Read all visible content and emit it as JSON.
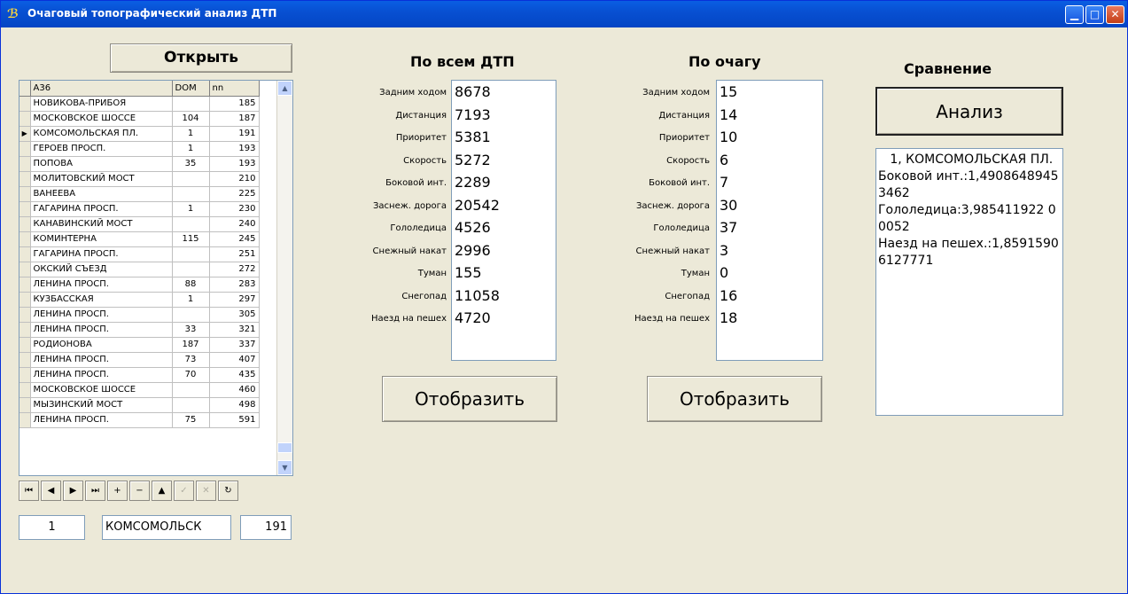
{
  "window": {
    "title": "Очаговый топографический анализ ДТП"
  },
  "open_button": "Открыть",
  "grid": {
    "columns": [
      "A36",
      "DOM",
      "nn"
    ],
    "rows": [
      [
        "НОВИКОВА-ПРИБОЯ",
        "",
        "185"
      ],
      [
        "МОСКОВСКОЕ ШОССЕ",
        "104",
        "187"
      ],
      [
        "КОМСОМОЛЬСКАЯ ПЛ.",
        "1",
        "191"
      ],
      [
        "ГЕРОЕВ ПРОСП.",
        "1",
        "193"
      ],
      [
        "ПОПОВА",
        "35",
        "193"
      ],
      [
        "МОЛИТОВСКИЙ МОСТ",
        "",
        "210"
      ],
      [
        "ВАНЕЕВА",
        "",
        "225"
      ],
      [
        "ГАГАРИНА ПРОСП.",
        "1",
        "230"
      ],
      [
        "КАНАВИНСКИЙ МОСТ",
        "",
        "240"
      ],
      [
        "КОМИНТЕРНА",
        "115",
        "245"
      ],
      [
        "ГАГАРИНА ПРОСП.",
        "",
        "251"
      ],
      [
        "ОКСКИЙ СЪЕЗД",
        "",
        "272"
      ],
      [
        "ЛЕНИНА ПРОСП.",
        "88",
        "283"
      ],
      [
        "КУЗБАССКАЯ",
        "1",
        "297"
      ],
      [
        "ЛЕНИНА ПРОСП.",
        "",
        "305"
      ],
      [
        "ЛЕНИНА ПРОСП.",
        "33",
        "321"
      ],
      [
        "РОДИОНОВА",
        "187",
        "337"
      ],
      [
        "ЛЕНИНА ПРОСП.",
        "73",
        "407"
      ],
      [
        "ЛЕНИНА ПРОСП.",
        "70",
        "435"
      ],
      [
        "МОСКОВСКОЕ ШОССЕ",
        "",
        "460"
      ],
      [
        "МЫЗИНСКИЙ МОСТ",
        "",
        "498"
      ],
      [
        "ЛЕНИНА ПРОСП.",
        "75",
        "591"
      ]
    ],
    "current_row_indicator": "▶"
  },
  "navigator": {
    "buttons": [
      {
        "name": "first",
        "glyph": "⏮"
      },
      {
        "name": "prior",
        "glyph": "◀"
      },
      {
        "name": "next",
        "glyph": "▶"
      },
      {
        "name": "last",
        "glyph": "⏭"
      },
      {
        "name": "insert",
        "glyph": "+"
      },
      {
        "name": "delete",
        "glyph": "−"
      },
      {
        "name": "edit",
        "glyph": "▲"
      },
      {
        "name": "post",
        "glyph": "✓"
      },
      {
        "name": "cancel",
        "glyph": "✕"
      },
      {
        "name": "refresh",
        "glyph": "↻"
      }
    ]
  },
  "fields": {
    "dom": "1",
    "street": "КОМСОМОЛЬСК",
    "nn": "191"
  },
  "all_accidents": {
    "title": "По всем ДТП",
    "labels": [
      "Задним ходом",
      "Дистанция",
      "Приоритет",
      "Скорость",
      "Боковой инт.",
      "Заснеж. дорога",
      "Гололедица",
      "Снежный накат",
      "Туман",
      "Снегопад",
      "Наезд на пешех"
    ],
    "values": [
      "8678",
      "7193",
      "5381",
      "5272",
      "2289",
      "20542",
      "4526",
      "2996",
      "155",
      "11058",
      "4720"
    ],
    "button": "Отобразить"
  },
  "focus": {
    "title": "По очагу",
    "labels": [
      "Задним ходом",
      "Дистанция",
      "Приоритет",
      "Скорость",
      "Боковой инт.",
      "Заснеж. дорога",
      "Гололедица",
      "Снежный накат",
      "Туман",
      "Снегопад",
      "Наезд на пешех"
    ],
    "values": [
      "15",
      "14",
      "10",
      "6",
      "7",
      "30",
      "37",
      "3",
      "0",
      "16",
      "18"
    ],
    "button": "Отобразить"
  },
  "comparison": {
    "title": "Сравнение",
    "button": "Анализ",
    "result": "   1, КОМСОМОЛЬСКАЯ ПЛ.\nБоковой инт.:1,49086489453462\nГололедица:3,985411922 00052\nНаезд на пешех.:1,85915906127771"
  }
}
